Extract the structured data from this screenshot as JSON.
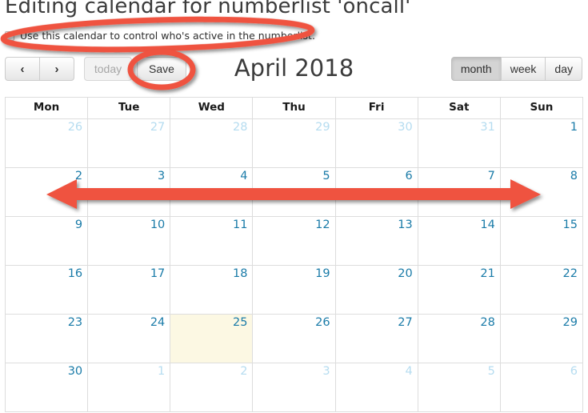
{
  "page": {
    "title": "Editing calendar for numberlist 'oncall'"
  },
  "control_checkbox": {
    "label": "Use this calendar to control who's active in the numberlist.",
    "checked": false
  },
  "toolbar": {
    "prev_label": "‹",
    "next_label": "›",
    "today_label": "today",
    "today_disabled": true,
    "save_label": "Save",
    "title": "April 2018",
    "views": [
      {
        "label": "month",
        "active": true
      },
      {
        "label": "week",
        "active": false
      },
      {
        "label": "day",
        "active": false
      }
    ]
  },
  "calendar": {
    "day_headers": [
      "Mon",
      "Tue",
      "Wed",
      "Thu",
      "Fri",
      "Sat",
      "Sun"
    ],
    "weeks": [
      [
        {
          "num": "26",
          "other_month": true,
          "highlight": false
        },
        {
          "num": "27",
          "other_month": true,
          "highlight": false
        },
        {
          "num": "28",
          "other_month": true,
          "highlight": false
        },
        {
          "num": "29",
          "other_month": true,
          "highlight": false
        },
        {
          "num": "30",
          "other_month": true,
          "highlight": false
        },
        {
          "num": "31",
          "other_month": true,
          "highlight": false
        },
        {
          "num": "1",
          "other_month": false,
          "highlight": false
        }
      ],
      [
        {
          "num": "2",
          "other_month": false,
          "highlight": false
        },
        {
          "num": "3",
          "other_month": false,
          "highlight": false
        },
        {
          "num": "4",
          "other_month": false,
          "highlight": false
        },
        {
          "num": "5",
          "other_month": false,
          "highlight": false
        },
        {
          "num": "6",
          "other_month": false,
          "highlight": false
        },
        {
          "num": "7",
          "other_month": false,
          "highlight": false
        },
        {
          "num": "8",
          "other_month": false,
          "highlight": false
        }
      ],
      [
        {
          "num": "9",
          "other_month": false,
          "highlight": false
        },
        {
          "num": "10",
          "other_month": false,
          "highlight": false
        },
        {
          "num": "11",
          "other_month": false,
          "highlight": false
        },
        {
          "num": "12",
          "other_month": false,
          "highlight": false
        },
        {
          "num": "13",
          "other_month": false,
          "highlight": false
        },
        {
          "num": "14",
          "other_month": false,
          "highlight": false
        },
        {
          "num": "15",
          "other_month": false,
          "highlight": false
        }
      ],
      [
        {
          "num": "16",
          "other_month": false,
          "highlight": false
        },
        {
          "num": "17",
          "other_month": false,
          "highlight": false
        },
        {
          "num": "18",
          "other_month": false,
          "highlight": false
        },
        {
          "num": "19",
          "other_month": false,
          "highlight": false
        },
        {
          "num": "20",
          "other_month": false,
          "highlight": false
        },
        {
          "num": "21",
          "other_month": false,
          "highlight": false
        },
        {
          "num": "22",
          "other_month": false,
          "highlight": false
        }
      ],
      [
        {
          "num": "23",
          "other_month": false,
          "highlight": false
        },
        {
          "num": "24",
          "other_month": false,
          "highlight": false
        },
        {
          "num": "25",
          "other_month": false,
          "highlight": true
        },
        {
          "num": "26",
          "other_month": false,
          "highlight": false
        },
        {
          "num": "27",
          "other_month": false,
          "highlight": false
        },
        {
          "num": "28",
          "other_month": false,
          "highlight": false
        },
        {
          "num": "29",
          "other_month": false,
          "highlight": false
        }
      ],
      [
        {
          "num": "30",
          "other_month": false,
          "highlight": false
        },
        {
          "num": "1",
          "other_month": true,
          "highlight": false
        },
        {
          "num": "2",
          "other_month": true,
          "highlight": false
        },
        {
          "num": "3",
          "other_month": true,
          "highlight": false
        },
        {
          "num": "4",
          "other_month": true,
          "highlight": false
        },
        {
          "num": "5",
          "other_month": true,
          "highlight": false
        },
        {
          "num": "6",
          "other_month": true,
          "highlight": false
        }
      ]
    ]
  },
  "annotations": {
    "color": "#ef5340",
    "items": [
      {
        "name": "checkbox-highlight-ellipse",
        "shape": "ellipse"
      },
      {
        "name": "save-button-highlight-ellipse",
        "shape": "ellipse"
      },
      {
        "name": "week-row-double-arrow",
        "shape": "double-arrow"
      }
    ]
  },
  "colors": {
    "date_text": "#1a7ba8",
    "other_month_date_text": "#b5dcf0",
    "today_cell_background": "#fcf8e3",
    "grid_line": "#dddddd",
    "annotation_red": "#ef5340"
  }
}
